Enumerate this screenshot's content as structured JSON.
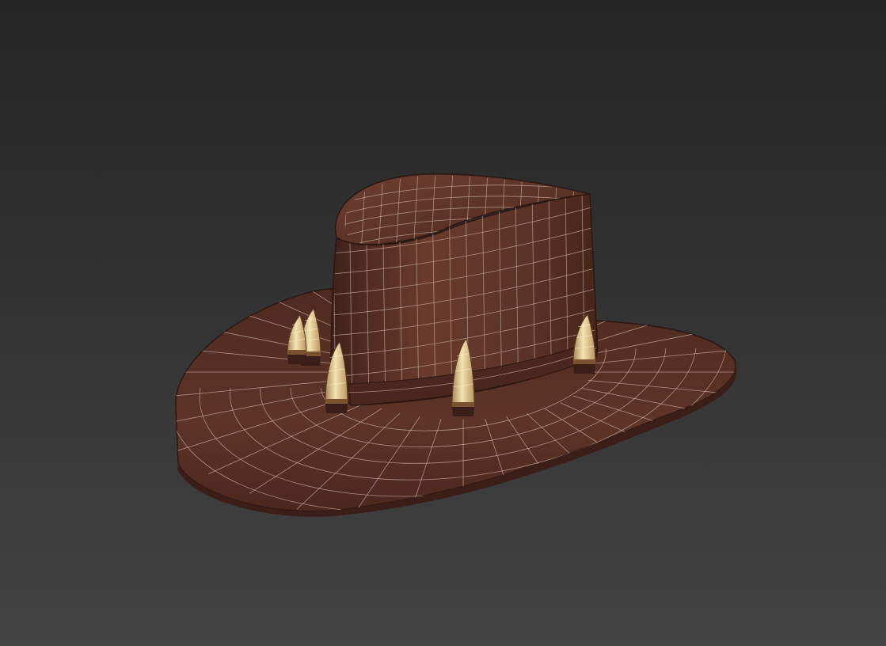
{
  "viewport": {
    "background": {
      "top": "#252525",
      "bottom": "#434343"
    }
  },
  "model": {
    "subject": "hat",
    "leather_color": "#5a3226",
    "leather_dark": "#3e2019",
    "wire_color": "#c9b2a8",
    "band_color": "#4a271e",
    "tooth_color": "#e6cf98",
    "tooth_count": 5
  }
}
